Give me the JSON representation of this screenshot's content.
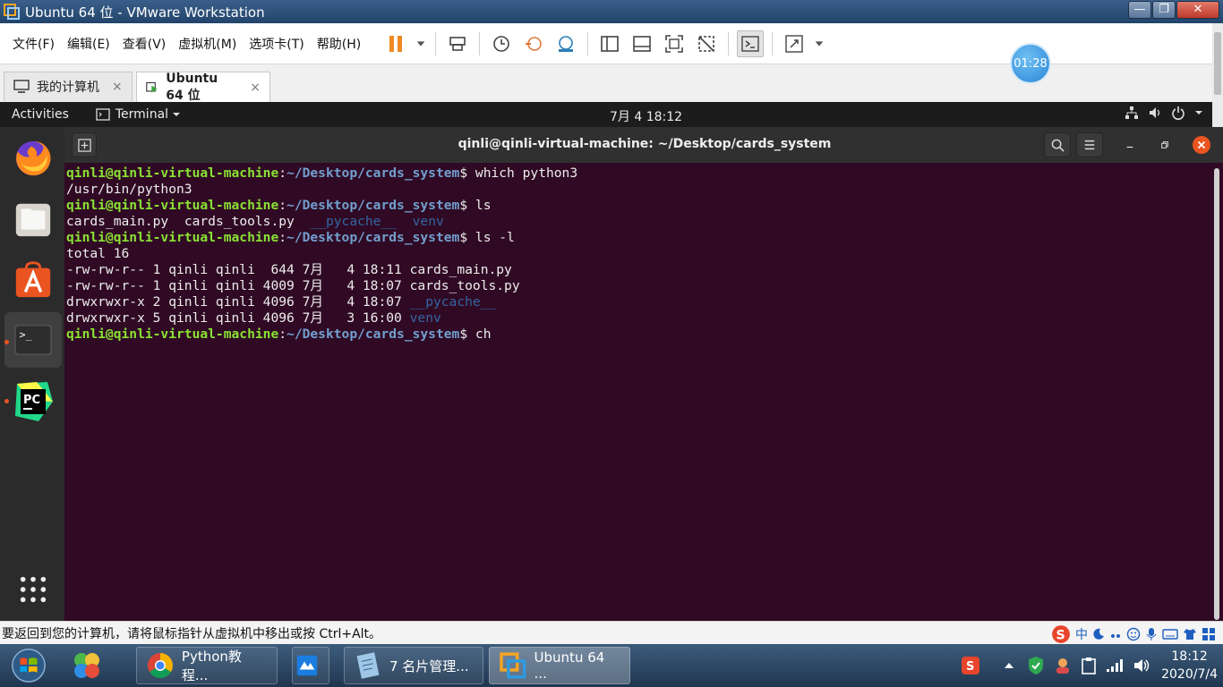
{
  "window": {
    "title": "Ubuntu 64 位 - VMware Workstation"
  },
  "menu": {
    "items": [
      "文件(F)",
      "编辑(E)",
      "查看(V)",
      "虚拟机(M)",
      "选项卡(T)",
      "帮助(H)"
    ]
  },
  "timer": {
    "text": "01:28"
  },
  "tabs": [
    {
      "label": "我的计算机",
      "close": "×"
    },
    {
      "label": "Ubuntu 64 位",
      "close": "×"
    }
  ],
  "ubuntu": {
    "activities": "Activities",
    "app_menu": "Terminal",
    "clock": "7月 4  18:12"
  },
  "terminal": {
    "title": "qinli@qinli-virtual-machine: ~/Desktop/cards_system",
    "prompt_user": "qinli@qinli-virtual-machine",
    "prompt_path": "~/Desktop/cards_system",
    "cmd1": "which python3",
    "out1": "/usr/bin/python3",
    "cmd2": "ls",
    "ls_file1": "cards_main.py",
    "ls_file2": "cards_tools.py",
    "ls_dir1": "__pycache__",
    "ls_dir2": "venv",
    "cmd3": "ls -l",
    "total": "total 16",
    "rows": [
      {
        "meta": "-rw-rw-r-- 1 qinli qinli  644 7月   4 18:11 ",
        "name": "cards_main.py",
        "dir": false
      },
      {
        "meta": "-rw-rw-r-- 1 qinli qinli 4009 7月   4 18:07 ",
        "name": "cards_tools.py",
        "dir": false
      },
      {
        "meta": "drwxrwxr-x 2 qinli qinli 4096 7月   4 18:07 ",
        "name": "__pycache__",
        "dir": true
      },
      {
        "meta": "drwxrwxr-x 5 qinli qinli 4096 7月   3 16:00 ",
        "name": "venv",
        "dir": true
      }
    ],
    "cmd4": "ch"
  },
  "status": {
    "hint": "要返回到您的计算机，请将鼠标指针从虚拟机中移出或按 Ctrl+Alt。",
    "ime_lang": "中"
  },
  "taskbar": {
    "items": [
      "Python教程...",
      "7 名片管理...",
      "Ubuntu 64 ..."
    ],
    "time": "18:12",
    "date": "2020/7/4"
  },
  "colors": {
    "terminal_bg": "#300a24",
    "prompt_user": "#8ae234",
    "prompt_path": "#729fcf",
    "accent": "#e95420"
  }
}
